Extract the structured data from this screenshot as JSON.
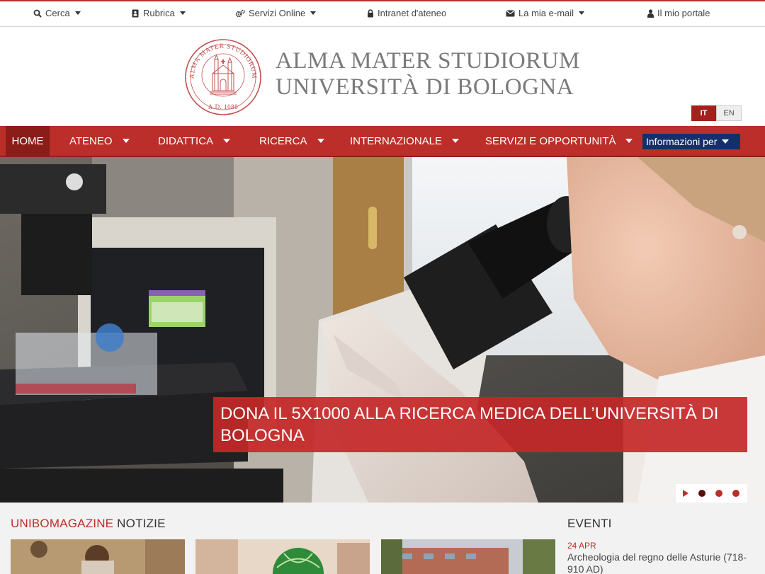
{
  "topbar": {
    "items": [
      {
        "label": "Cerca",
        "icon": "search-icon",
        "dropdown": true
      },
      {
        "label": "Rubrica",
        "icon": "address-book-icon",
        "dropdown": true
      },
      {
        "label": "Servizi Online",
        "icon": "gears-icon",
        "dropdown": true
      },
      {
        "label": "Intranet d'ateneo",
        "icon": "lock-icon",
        "dropdown": false
      },
      {
        "label": "La mia e-mail",
        "icon": "envelope-icon",
        "dropdown": true
      },
      {
        "label": "Il mio portale",
        "icon": "user-icon",
        "dropdown": false
      }
    ]
  },
  "header": {
    "brand_line1": "ALMA MATER STUDIORUM",
    "brand_line2": "UNIVERSITÀ DI BOLOGNA",
    "seal_text_top": "ALMA MATER STUDIORUM",
    "seal_text_bottom": "A.D. 1088",
    "lang": {
      "active": "IT",
      "other": "EN"
    }
  },
  "nav": {
    "home": "HOME",
    "items": [
      "ATENEO",
      "DIDATTICA",
      "RICERCA",
      "INTERNAZIONALE",
      "SERVIZI E OPPORTUNITÀ"
    ],
    "info": "Informazioni per"
  },
  "hero": {
    "caption": "DONA IL 5X1000 ALLA RICERCA MEDICA DELL’UNIVERSITÀ DI BOLOGNA",
    "slides": 3,
    "active_slide": 1
  },
  "magazine": {
    "title_red": "UNIBOMAGAZINE",
    "title_dark": "NOTIZIE"
  },
  "events": {
    "title": "EVENTI",
    "items": [
      {
        "date": "24 APR",
        "title": "Archeologia del regno delle Asturie (718-910 AD)"
      }
    ]
  },
  "colors": {
    "brand_red": "#bb2e29",
    "dark_red": "#8a1d18",
    "navy": "#14306b"
  }
}
